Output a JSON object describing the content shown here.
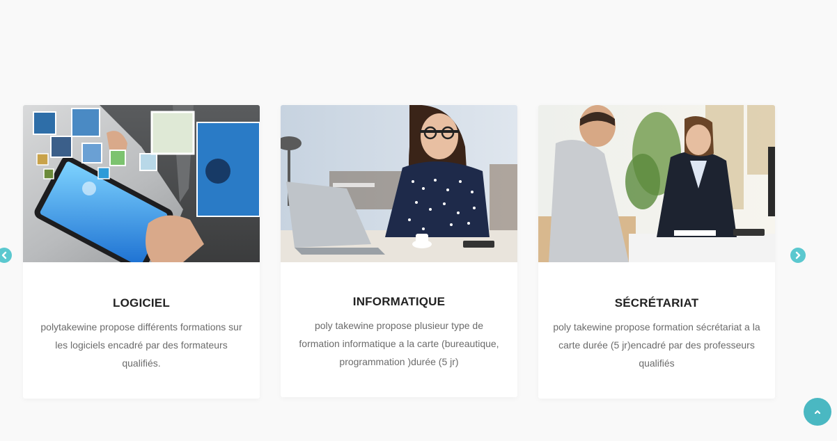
{
  "cards": [
    {
      "title": "LOGICIEL",
      "description": "polytakewine propose différents formations sur les logiciels encadré par des formateurs qualifiés.",
      "image": "tablet-cubes-image"
    },
    {
      "title": "INFORMATIQUE",
      "description": "poly takewine propose plusieur type de formation informatique a la carte (bureautique, programmation )durée (5 jr)",
      "image": "woman-laptop-image"
    },
    {
      "title": "SÉCRÉTARIAT",
      "description": "poly takewine propose formation sécrétariat a la carte durée (5 jr)encadré par des professeurs qualifiés",
      "image": "office-meeting-image"
    }
  ],
  "navigation": {
    "prev_icon": "chevron-left-icon",
    "next_icon": "chevron-right-icon",
    "back_to_top_icon": "chevron-up-icon"
  },
  "colors": {
    "background": "#f9f9f9",
    "accent": "#5bc8cf",
    "back_to_top": "#4ab8c2",
    "title": "#222222",
    "text": "#6b6b6b"
  }
}
